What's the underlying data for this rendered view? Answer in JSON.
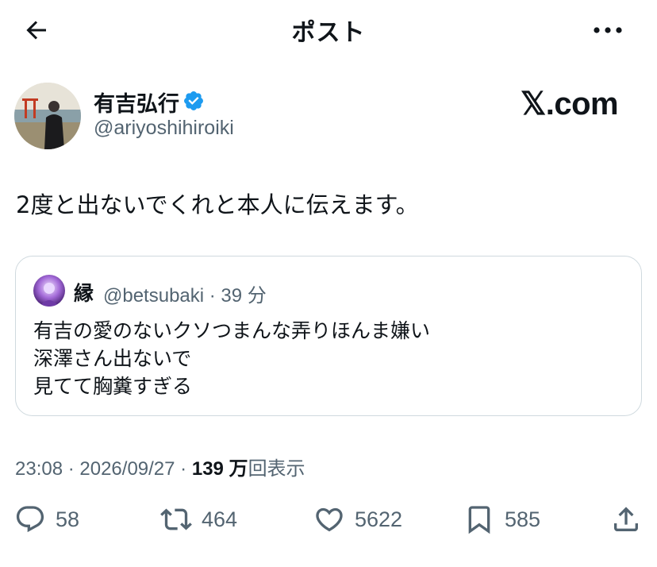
{
  "header": {
    "title": "ポスト",
    "back_icon": "arrow-left-icon",
    "more_icon": "more-horizontal-icon"
  },
  "author": {
    "name": "有吉弘行",
    "handle": "@ariyoshihiroiki",
    "verified": true
  },
  "brand": "𝕏.com",
  "tweet": {
    "text": "2度と出ないでくれと本人に伝えます。"
  },
  "quote": {
    "name": "縁",
    "meta": "@betsubaki · 39 分",
    "lines": [
      "有吉の愛のないクソつまんな弄りほんま嫌い",
      "深澤さん出ないで",
      "見てて胸糞すぎる"
    ]
  },
  "stats": {
    "time": "23:08 · 2026/09/27 · ",
    "views_count": "139 万",
    "views_label": "回表示"
  },
  "actions": {
    "reply": "58",
    "retweet": "464",
    "like": "5622",
    "bookmark": "585"
  },
  "colors": {
    "text": "#0f1419",
    "muted": "#536471",
    "verified_blue": "#1d9bf0",
    "border": "#cfd9de"
  }
}
